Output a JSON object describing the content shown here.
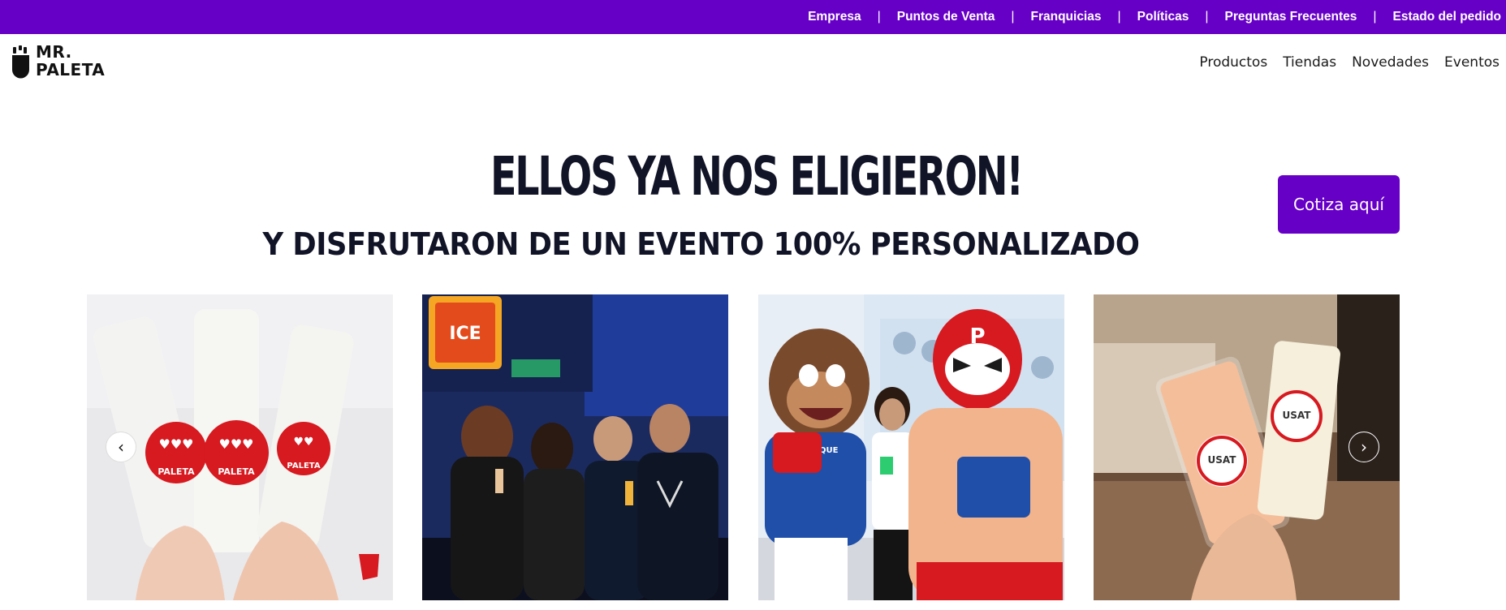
{
  "top_nav": {
    "items": [
      "Empresa",
      "Puntos de Venta",
      "Franquicias",
      "Políticas",
      "Preguntas Frecuentes",
      "Estado del pedido"
    ],
    "separator": "|"
  },
  "brand": {
    "line1": "MR.",
    "line2": "PALETA"
  },
  "main_nav": {
    "items": [
      "Productos",
      "Tiendas",
      "Novedades",
      "Eventos"
    ]
  },
  "hero": {
    "title": "ELLOS YA NOS ELIGIERON!",
    "subtitle": "Y DISFRUTARON DE UN EVENTO 100% PERSONALIZADO",
    "cta_label": "Cotiza aquí"
  },
  "carousel": {
    "prev_icon": "chevron-left-icon",
    "next_icon": "chevron-right-icon",
    "slides": [
      {
        "name": "slide-paletas-hands",
        "labels": [
          "PALETA",
          "PALETA",
          "PALETA"
        ]
      },
      {
        "name": "slide-group-concert",
        "labels": [
          "ICE"
        ]
      },
      {
        "name": "slide-mascots",
        "labels": [
          "P",
          "SAN ROQUE"
        ]
      },
      {
        "name": "slide-usat-paletas",
        "labels": [
          "USAT",
          "USAT"
        ]
      }
    ]
  },
  "colors": {
    "brand_purple": "#6700c7",
    "title_navy": "#111427",
    "paleta_red": "#d71920"
  }
}
